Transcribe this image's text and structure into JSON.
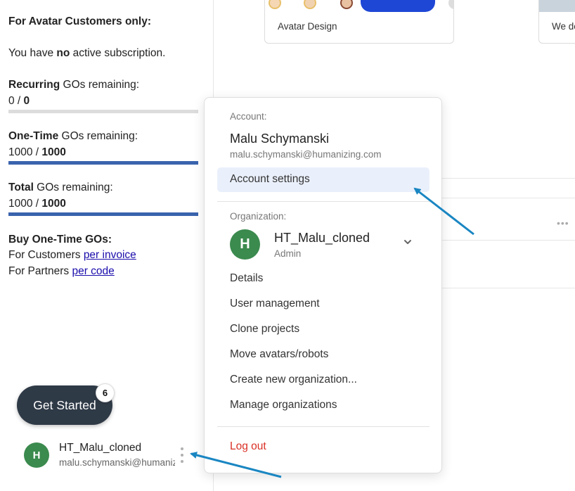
{
  "sidebar": {
    "heading": "For Avatar Customers only:",
    "subscription": {
      "prefix": "You have ",
      "emph": "no",
      "suffix": " active subscription."
    },
    "recurring": {
      "label_bold": "Recurring",
      "label_rest": " GOs remaining:",
      "used": "0",
      "sep": " / ",
      "total": "0",
      "fill_fraction": 0
    },
    "one_time": {
      "label_bold": "One-Time",
      "label_rest": " GOs remaining:",
      "used": "1000",
      "sep": " / ",
      "total": "1000",
      "fill_fraction": 1
    },
    "total": {
      "label_bold": "Total",
      "label_rest": " GOs remaining:",
      "used": "1000",
      "sep": " / ",
      "total": "1000",
      "fill_fraction": 1
    },
    "buy": {
      "heading": "Buy One-Time GOs:",
      "customers_prefix": "For Customers ",
      "customers_link": "per invoice",
      "partners_prefix": "For Partners ",
      "partners_link": "per code"
    },
    "get_started": {
      "label": "Get Started",
      "badge": "6"
    },
    "user": {
      "initial": "H",
      "name": "HT_Malu_cloned",
      "email": "malu.schymanski@humanizing.com"
    }
  },
  "background": {
    "cards": [
      {
        "label": "Avatar Design"
      },
      {
        "label": "We de"
      }
    ]
  },
  "menu": {
    "account_header": "Account:",
    "user_name": "Malu Schymanski",
    "user_email": "malu.schymanski@humanizing.com",
    "account_settings": "Account settings",
    "org_header": "Organization:",
    "org_initial": "H",
    "org_name": "HT_Malu_cloned",
    "org_role": "Admin",
    "items": [
      "Details",
      "User management",
      "Clone projects",
      "Move avatars/robots",
      "Create new organization...",
      "Manage organizations"
    ],
    "logout": "Log out"
  },
  "colors": {
    "bar_filled": "#3a63ad",
    "bar_empty": "#dcdcdc",
    "avatar_green": "#3b8a4e",
    "get_started_bg": "#2f3a47",
    "highlight": "#eaf0fb",
    "logout": "#d93025",
    "arrow": "#1a86c2"
  },
  "icons": {
    "org_chevron": "chevron-down-icon",
    "user_menu": "kebab-menu-icon",
    "row_menu": "more-horizontal-icon"
  }
}
